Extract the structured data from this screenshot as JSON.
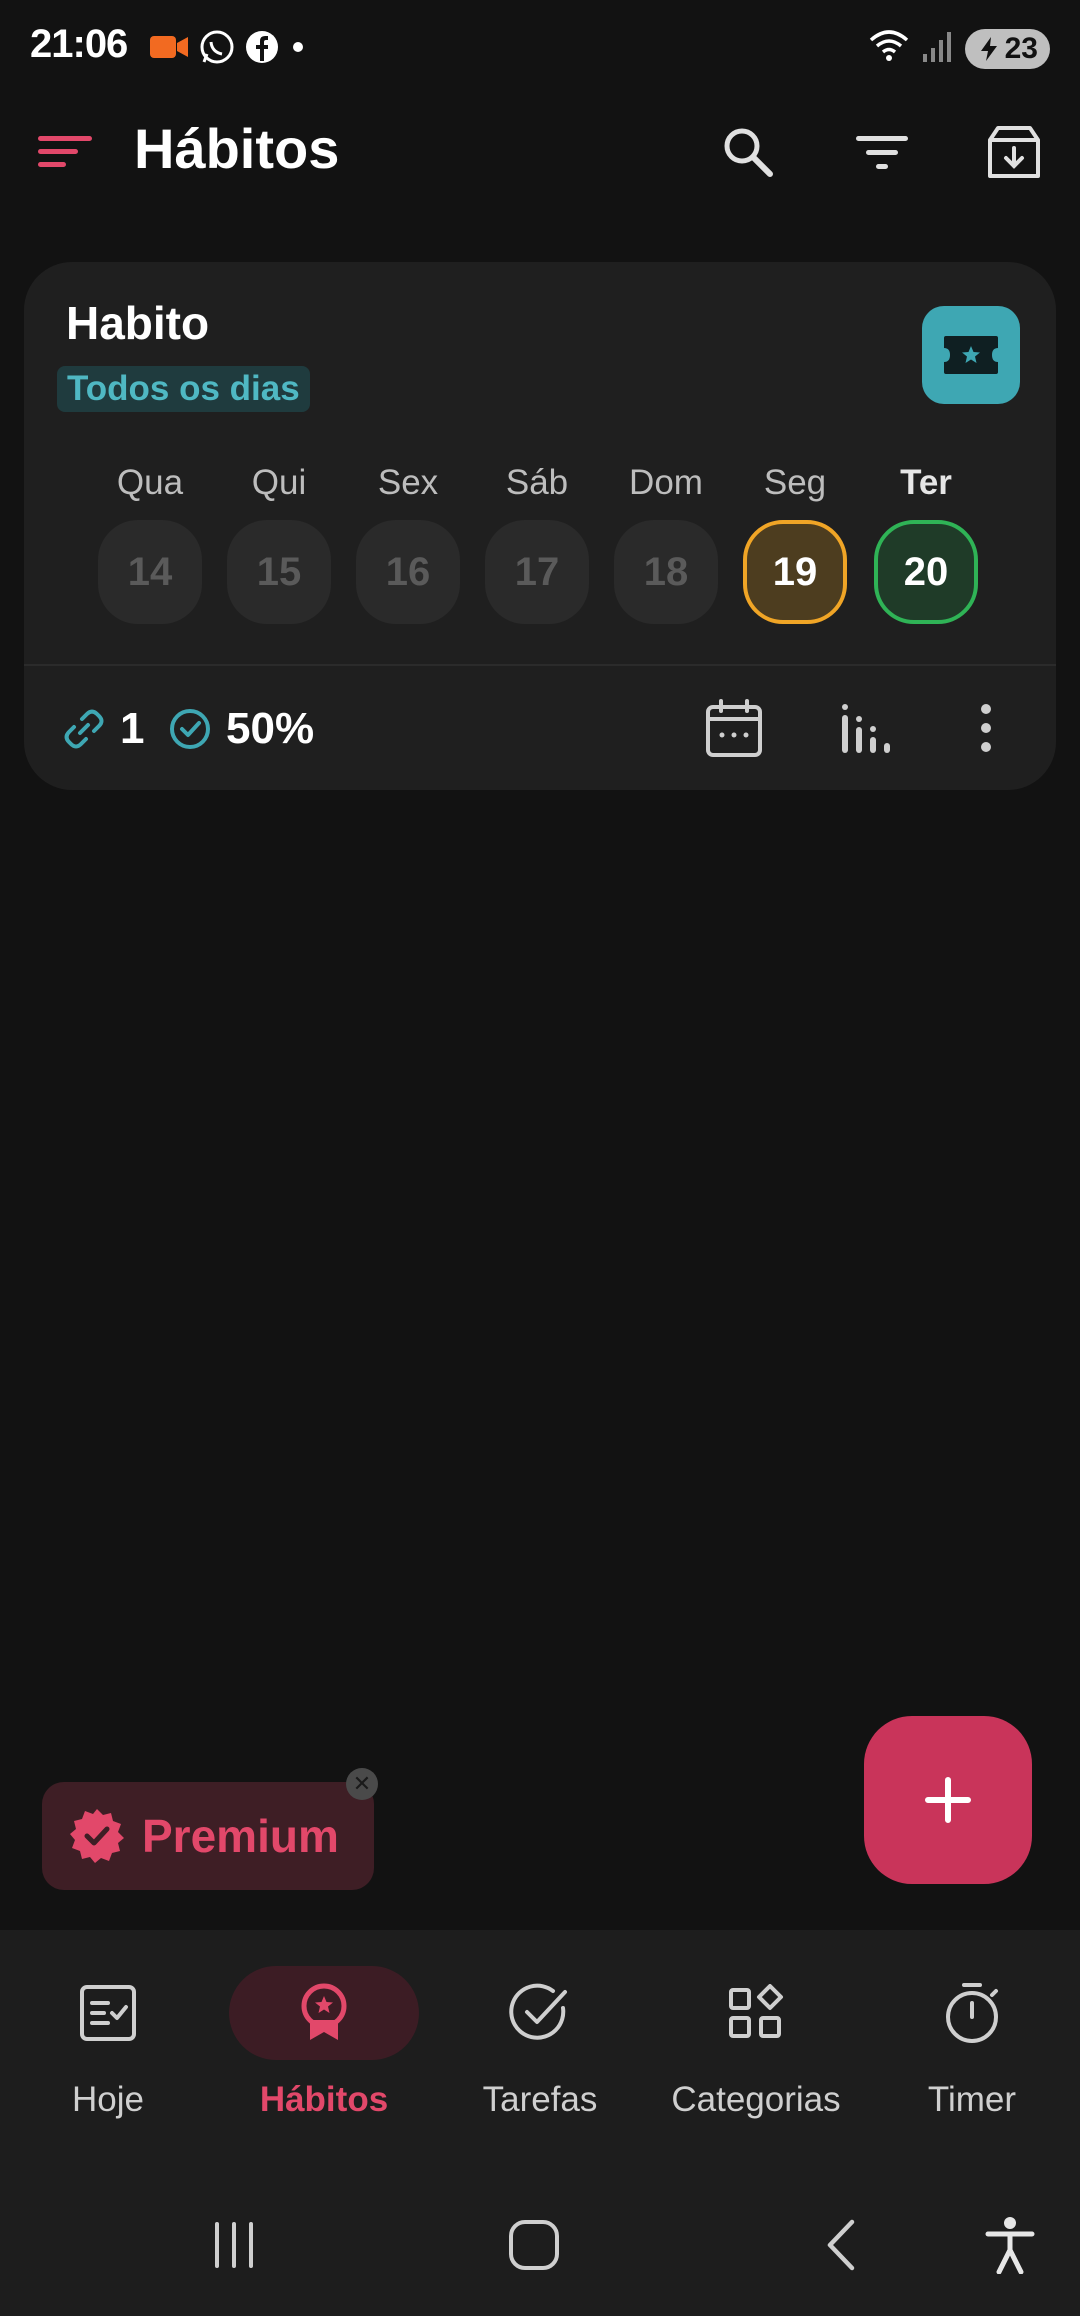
{
  "status_bar": {
    "time": "21:06",
    "battery": "23",
    "icons": [
      "video-recording-icon",
      "whatsapp-icon",
      "facebook-icon",
      "dot-icon",
      "wifi-icon",
      "signal-icon",
      "battery-icon"
    ]
  },
  "app_bar": {
    "title": "Hábitos",
    "actions": [
      "search-icon",
      "filter-icon",
      "archive-icon"
    ]
  },
  "habit": {
    "name": "Habito",
    "frequency": "Todos os dias",
    "icon": "ticket-star-icon",
    "days": [
      {
        "label": "Qua",
        "date": "14",
        "state": "none"
      },
      {
        "label": "Qui",
        "date": "15",
        "state": "none"
      },
      {
        "label": "Sex",
        "date": "16",
        "state": "none"
      },
      {
        "label": "Sáb",
        "date": "17",
        "state": "none"
      },
      {
        "label": "Dom",
        "date": "18",
        "state": "none"
      },
      {
        "label": "Seg",
        "date": "19",
        "state": "partial"
      },
      {
        "label": "Ter",
        "date": "20",
        "state": "done"
      }
    ],
    "streak": "1",
    "success_rate": "50%"
  },
  "premium": {
    "label": "Premium"
  },
  "bottom_nav": [
    {
      "label": "Hoje",
      "icon": "checklist-icon",
      "active": false
    },
    {
      "label": "Hábitos",
      "icon": "award-icon",
      "active": true
    },
    {
      "label": "Tarefas",
      "icon": "check-circle-icon",
      "active": false
    },
    {
      "label": "Categorias",
      "icon": "categories-icon",
      "active": false
    },
    {
      "label": "Timer",
      "icon": "stopwatch-icon",
      "active": false
    }
  ],
  "colors": {
    "accent": "#e2486a",
    "fab": "#c9345a",
    "teal": "#3ea7b3",
    "partial": "#f0a526",
    "done": "#2fb356",
    "background": "#121212",
    "card": "#1f1f1f"
  }
}
